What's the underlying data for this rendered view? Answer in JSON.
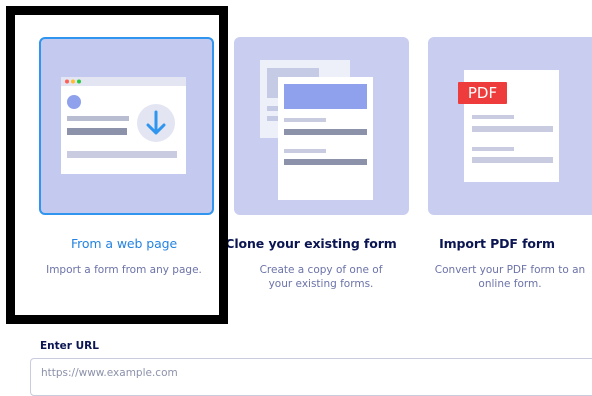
{
  "options": [
    {
      "title": "From a web page",
      "description": "Import a form from any page.",
      "selected": true
    },
    {
      "title": "Clone your existing form",
      "description": "Create a copy of one of your existing forms.",
      "selected": false
    },
    {
      "title": "Import PDF form",
      "description": "Convert your PDF form to an online form.",
      "selected": false
    }
  ],
  "pdf_badge": "PDF",
  "url_field": {
    "label": "Enter URL",
    "placeholder": "https://www.example.com",
    "value": ""
  },
  "colors": {
    "accent": "#2f95ee",
    "card_bg": "#c9cef0",
    "pdf_red": "#ee3b3b",
    "text": "#0a1551"
  }
}
